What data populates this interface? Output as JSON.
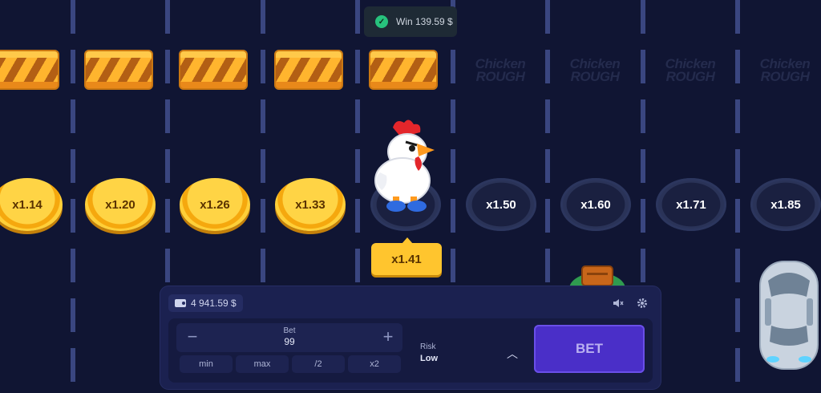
{
  "win_notice": {
    "text": "Win 139.59 $"
  },
  "lanes": [
    {
      "state": "passed",
      "multiplier": "x1.14"
    },
    {
      "state": "passed",
      "multiplier": "x1.20"
    },
    {
      "state": "passed",
      "multiplier": "x1.26"
    },
    {
      "state": "passed",
      "multiplier": "x1.33"
    },
    {
      "state": "current",
      "multiplier": "x1.41"
    },
    {
      "state": "upcoming",
      "multiplier": "x1.50",
      "sign": "Chicken ROUGH"
    },
    {
      "state": "upcoming",
      "multiplier": "x1.60",
      "sign": "Chicken ROUGH"
    },
    {
      "state": "upcoming",
      "multiplier": "x1.71",
      "sign": "Chicken ROUGH"
    },
    {
      "state": "upcoming",
      "multiplier": "x1.85",
      "sign": "Chicken ROUGH"
    }
  ],
  "sign": {
    "line1": "Chicken",
    "line2": "ROUGH"
  },
  "current_multiplier": "x1.41",
  "panel": {
    "balance": "4 941.59 $",
    "bet_label": "Bet",
    "bet_value": "99",
    "minus": "−",
    "plus": "+",
    "quick": [
      "min",
      "max",
      "/2",
      "x2"
    ],
    "risk_label": "Risk",
    "risk_value": "Low",
    "bet_button": "BET"
  },
  "colors": {
    "accent": "#4a2fc8",
    "coin": "#ffc52e",
    "background": "#101533"
  }
}
